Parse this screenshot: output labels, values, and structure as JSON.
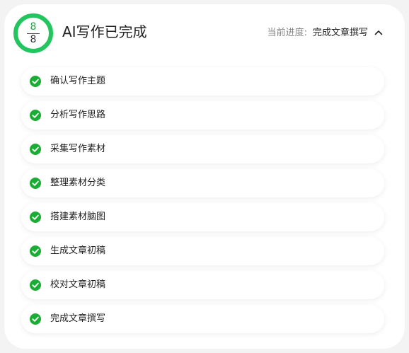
{
  "progress": {
    "completed": "8",
    "total": "8",
    "fraction": 1.0
  },
  "header": {
    "title": "AI写作已完成",
    "status_label": "当前进度:",
    "status_value": "完成文章撰写",
    "collapse_icon": "chevron-up-icon"
  },
  "steps": [
    {
      "label": "确认写作主题",
      "status": "done"
    },
    {
      "label": "分析写作思路",
      "status": "done"
    },
    {
      "label": "采集写作素材",
      "status": "done"
    },
    {
      "label": "整理素材分类",
      "status": "done"
    },
    {
      "label": "搭建素材脑图",
      "status": "done"
    },
    {
      "label": "生成文章初稿",
      "status": "done"
    },
    {
      "label": "校对文章初稿",
      "status": "done"
    },
    {
      "label": "完成文章撰写",
      "status": "done"
    }
  ],
  "colors": {
    "accent": "#22c55e",
    "check": "#1aad34"
  }
}
